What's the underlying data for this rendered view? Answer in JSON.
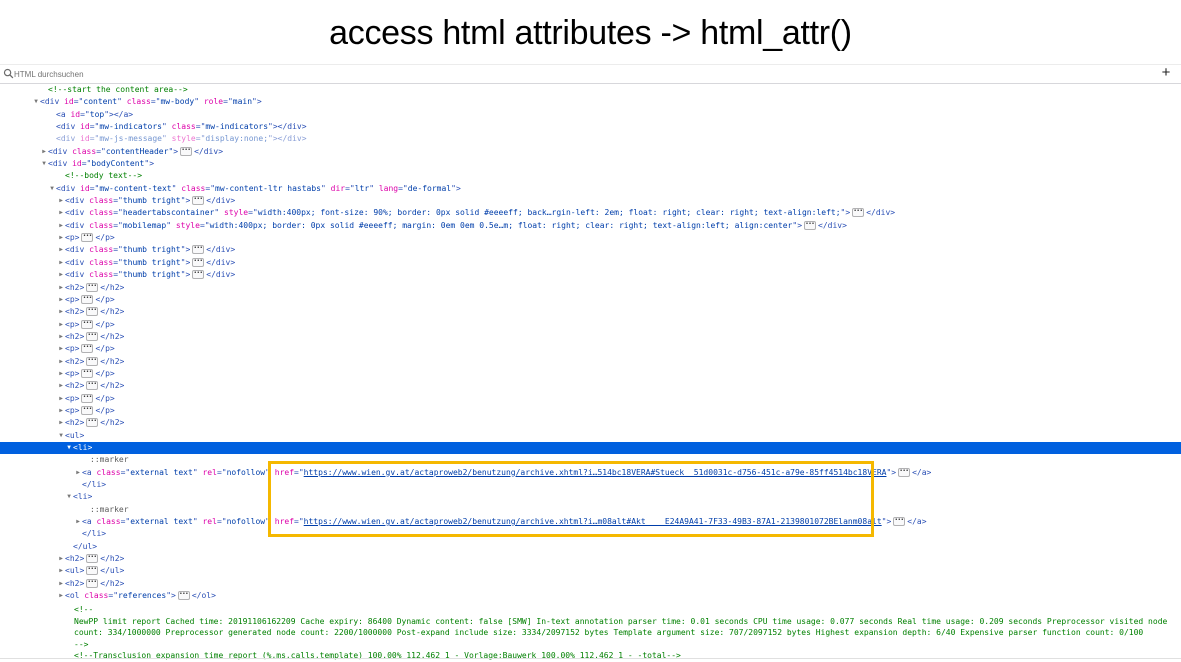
{
  "slide": {
    "title": "access html attributes -> html_attr()"
  },
  "toolbar": {
    "search_placeholder": "HTML durchsuchen",
    "add_label": "+"
  },
  "rows": [
    {
      "indent": 49,
      "tw": "",
      "kind": "comment",
      "text": "<!--start the content area-->"
    },
    {
      "indent": 41,
      "tw": "▼",
      "kind": "open",
      "tag": "div",
      "attrs": [
        [
          "id",
          "content"
        ],
        [
          "class",
          "mw-body"
        ],
        [
          "role",
          "main"
        ]
      ],
      "end": ">"
    },
    {
      "indent": 57,
      "tw": "",
      "kind": "open",
      "tag": "a",
      "attrs": [
        [
          "id",
          "top"
        ]
      ],
      "end": "></a>"
    },
    {
      "indent": 57,
      "tw": "",
      "kind": "open",
      "tag": "div",
      "attrs": [
        [
          "id",
          "mw-indicators"
        ],
        [
          "class",
          "mw-indicators"
        ]
      ],
      "end": "></div>"
    },
    {
      "indent": 57,
      "tw": "",
      "kind": "open",
      "tag": "div",
      "attrs": [
        [
          "id",
          "mw-js-message"
        ],
        [
          "style",
          "display:none;"
        ]
      ],
      "end": "></div>",
      "faded": true
    },
    {
      "indent": 49,
      "tw": "▶",
      "kind": "open",
      "tag": "div",
      "attrs": [
        [
          "class",
          "contentHeader"
        ]
      ],
      "end": ">",
      "badge": true,
      "close": "</div>"
    },
    {
      "indent": 49,
      "tw": "▼",
      "kind": "open",
      "tag": "div",
      "attrs": [
        [
          "id",
          "bodyContent"
        ]
      ],
      "end": ">"
    },
    {
      "indent": 66,
      "tw": "",
      "kind": "comment",
      "text": "<!--body text-->"
    },
    {
      "indent": 57,
      "tw": "▼",
      "kind": "open",
      "tag": "div",
      "attrs": [
        [
          "id",
          "mw-content-text"
        ],
        [
          "class",
          "mw-content-ltr hastabs"
        ],
        [
          "dir",
          "ltr"
        ],
        [
          "lang",
          "de-formal"
        ]
      ],
      "end": ">"
    },
    {
      "indent": 66,
      "tw": "▶",
      "kind": "open",
      "tag": "div",
      "attrs": [
        [
          "class",
          "thumb tright"
        ]
      ],
      "end": ">",
      "badge": true,
      "close": "</div>"
    },
    {
      "indent": 66,
      "tw": "▶",
      "kind": "open",
      "tag": "div",
      "attrs": [
        [
          "class",
          "headertabscontainer"
        ],
        [
          "style",
          "width:400px; font-size: 90%; border: 0px solid #eeeeff; back…rgin-left: 2em; float: right; clear: right; text-align:left;"
        ]
      ],
      "end": ">",
      "badge": true,
      "close": "</div>"
    },
    {
      "indent": 66,
      "tw": "▶",
      "kind": "open",
      "tag": "div",
      "attrs": [
        [
          "class",
          "mobilemap"
        ],
        [
          "style",
          "width:400px; border: 0px solid #eeeeff; margin: 0em 0em 0.5e…m; float: right; clear: right; text-align:left; align:center"
        ]
      ],
      "end": ">",
      "badge": true,
      "close": "</div>"
    },
    {
      "indent": 66,
      "tw": "▶",
      "kind": "open",
      "tag": "p",
      "attrs": [],
      "end": ">",
      "badge": true,
      "close": "</p>"
    },
    {
      "indent": 66,
      "tw": "▶",
      "kind": "open",
      "tag": "div",
      "attrs": [
        [
          "class",
          "thumb tright"
        ]
      ],
      "end": ">",
      "badge": true,
      "close": "</div>"
    },
    {
      "indent": 66,
      "tw": "▶",
      "kind": "open",
      "tag": "div",
      "attrs": [
        [
          "class",
          "thumb tright"
        ]
      ],
      "end": ">",
      "badge": true,
      "close": "</div>"
    },
    {
      "indent": 66,
      "tw": "▶",
      "kind": "open",
      "tag": "div",
      "attrs": [
        [
          "class",
          "thumb tright"
        ]
      ],
      "end": ">",
      "badge": true,
      "close": "</div>"
    },
    {
      "indent": 66,
      "tw": "▶",
      "kind": "open",
      "tag": "h2",
      "attrs": [],
      "end": ">",
      "badge": true,
      "close": "</h2>"
    },
    {
      "indent": 66,
      "tw": "▶",
      "kind": "open",
      "tag": "p",
      "attrs": [],
      "end": ">",
      "badge": true,
      "close": "</p>"
    },
    {
      "indent": 66,
      "tw": "▶",
      "kind": "open",
      "tag": "h2",
      "attrs": [],
      "end": ">",
      "badge": true,
      "close": "</h2>"
    },
    {
      "indent": 66,
      "tw": "▶",
      "kind": "open",
      "tag": "p",
      "attrs": [],
      "end": ">",
      "badge": true,
      "close": "</p>"
    },
    {
      "indent": 66,
      "tw": "▶",
      "kind": "open",
      "tag": "h2",
      "attrs": [],
      "end": ">",
      "badge": true,
      "close": "</h2>"
    },
    {
      "indent": 66,
      "tw": "▶",
      "kind": "open",
      "tag": "p",
      "attrs": [],
      "end": ">",
      "badge": true,
      "close": "</p>"
    },
    {
      "indent": 66,
      "tw": "▶",
      "kind": "open",
      "tag": "h2",
      "attrs": [],
      "end": ">",
      "badge": true,
      "close": "</h2>"
    },
    {
      "indent": 66,
      "tw": "▶",
      "kind": "open",
      "tag": "p",
      "attrs": [],
      "end": ">",
      "badge": true,
      "close": "</p>"
    },
    {
      "indent": 66,
      "tw": "▶",
      "kind": "open",
      "tag": "h2",
      "attrs": [],
      "end": ">",
      "badge": true,
      "close": "</h2>"
    },
    {
      "indent": 66,
      "tw": "▶",
      "kind": "open",
      "tag": "p",
      "attrs": [],
      "end": ">",
      "badge": true,
      "close": "</p>"
    },
    {
      "indent": 66,
      "tw": "▶",
      "kind": "open",
      "tag": "p",
      "attrs": [],
      "end": ">",
      "badge": true,
      "close": "</p>"
    },
    {
      "indent": 66,
      "tw": "▶",
      "kind": "open",
      "tag": "h2",
      "attrs": [],
      "end": ">",
      "badge": true,
      "close": "</h2>"
    },
    {
      "indent": 66,
      "tw": "▼",
      "kind": "open",
      "tag": "ul",
      "attrs": [],
      "end": ">"
    },
    {
      "indent": 74,
      "tw": "▼",
      "kind": "open",
      "tag": "li",
      "attrs": [],
      "end": ">",
      "selected": true
    },
    {
      "indent": 91,
      "tw": "",
      "kind": "pseudo",
      "text": "::marker"
    },
    {
      "indent": 83,
      "tw": "▶",
      "kind": "link",
      "tag": "a",
      "attrs": [
        [
          "class",
          "external text"
        ],
        [
          "rel",
          "nofollow"
        ]
      ],
      "href": "https://www.wien.gv.at/actaproweb2/benutzung/archive.xhtml?i…514bc18VERA#Stueck__51d0031c-d756-451c-a79e-85ff4514bc18VERA",
      "close": "</a>"
    },
    {
      "indent": 83,
      "tw": "",
      "kind": "close",
      "text": "</li>"
    },
    {
      "indent": 74,
      "tw": "▼",
      "kind": "open",
      "tag": "li",
      "attrs": [],
      "end": ">"
    },
    {
      "indent": 91,
      "tw": "",
      "kind": "pseudo",
      "text": "::marker"
    },
    {
      "indent": 83,
      "tw": "▶",
      "kind": "link",
      "tag": "a",
      "attrs": [
        [
          "class",
          "external text"
        ],
        [
          "rel",
          "nofollow"
        ]
      ],
      "href": "https://www.wien.gv.at/actaproweb2/benutzung/archive.xhtml?i…m08alt#Akt____E24A9A41-7F33-49B3-87A1-2139801072BElanm08alt",
      "close": "</a>"
    },
    {
      "indent": 83,
      "tw": "",
      "kind": "close",
      "text": "</li>"
    },
    {
      "indent": 74,
      "tw": "",
      "kind": "close",
      "text": "</ul>"
    },
    {
      "indent": 66,
      "tw": "▶",
      "kind": "open",
      "tag": "h2",
      "attrs": [],
      "end": ">",
      "badge": true,
      "close": "</h2>"
    },
    {
      "indent": 66,
      "tw": "▶",
      "kind": "open",
      "tag": "ul",
      "attrs": [],
      "end": ">",
      "badge": true,
      "close": "</ul>"
    },
    {
      "indent": 66,
      "tw": "▶",
      "kind": "open",
      "tag": "h2",
      "attrs": [],
      "end": ">",
      "badge": true,
      "close": "</h2>"
    },
    {
      "indent": 66,
      "tw": "▶",
      "kind": "open",
      "tag": "ol",
      "attrs": [
        [
          "class",
          "references"
        ]
      ],
      "end": ">",
      "badge": true,
      "close": "</ol>"
    }
  ],
  "footer_comment": "<!--\nNewPP limit report Cached time: 20191106162209 Cache expiry: 86400 Dynamic content: false [SMW] In-text annotation parser time: 0.01 seconds CPU time usage: 0.077 seconds Real time usage: 0.209 seconds Preprocessor visited node count: 334/1000000 Preprocessor generated node count: 2200/1000000 Post-expand include size: 3334/2097152 bytes Template argument size: 707/2097152 bytes Highest expansion depth: 6/40 Expensive parser function count: 0/100\n-->\n<!--Transclusion expansion time report (%,ms,calls,template) 100.00% 112.462 1 - Vorlage:Bauwerk 100.00% 112.462 1 - -total-->"
}
